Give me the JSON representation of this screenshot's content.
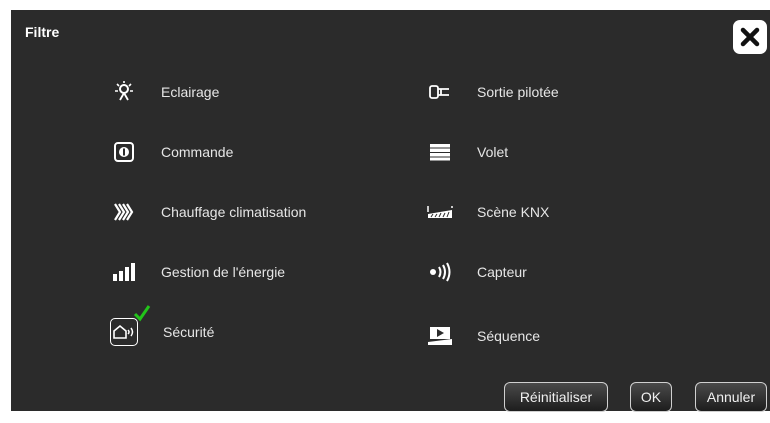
{
  "dialog": {
    "title": "Filtre",
    "close_icon": "close-icon"
  },
  "filters": [
    {
      "label": "Eclairage",
      "icon": "lightbulb-icon",
      "selected": false
    },
    {
      "label": "Commande",
      "icon": "command-icon",
      "selected": false
    },
    {
      "label": "Chauffage climatisation",
      "icon": "heating-icon",
      "selected": false
    },
    {
      "label": "Gestion de l'énergie",
      "icon": "energy-bars-icon",
      "selected": false
    },
    {
      "label": "Sécurité",
      "icon": "security-home-icon",
      "selected": true
    },
    {
      "label": "Sortie pilotée",
      "icon": "plug-icon",
      "selected": false
    },
    {
      "label": "Volet",
      "icon": "shutter-icon",
      "selected": false
    },
    {
      "label": "Scène KNX",
      "icon": "knx-scene-icon",
      "selected": false
    },
    {
      "label": "Capteur",
      "icon": "sensor-icon",
      "selected": false
    },
    {
      "label": "Séquence",
      "icon": "sequence-play-icon",
      "selected": false
    }
  ],
  "buttons": {
    "reset": "Réinitialiser",
    "ok": "OK",
    "cancel": "Annuler"
  },
  "colors": {
    "background": "#2b2b2b",
    "text": "#e6e6e6",
    "check": "#22c41a"
  }
}
